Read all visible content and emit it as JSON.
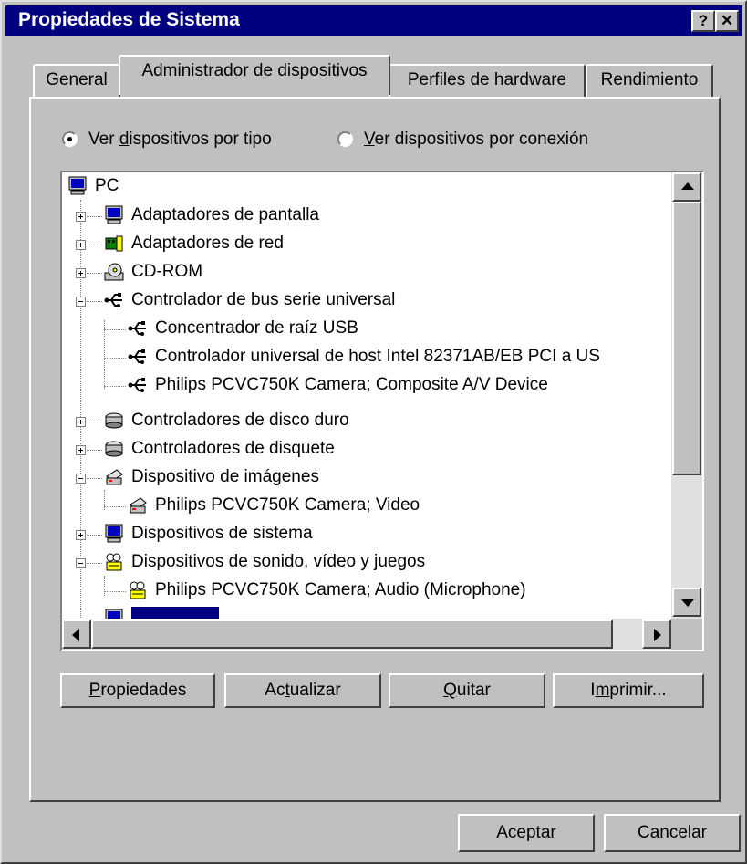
{
  "window": {
    "title": "Propiedades de Sistema",
    "help_glyph": "?",
    "close_glyph": "✕"
  },
  "tabs": [
    {
      "label": "General",
      "active": false
    },
    {
      "label": "Administrador de dispositivos",
      "active": true
    },
    {
      "label": "Perfiles de hardware",
      "active": false
    },
    {
      "label": "Rendimiento",
      "active": false
    }
  ],
  "view_options": {
    "by_type": {
      "mnemonic": "d",
      "before": "Ver ",
      "after": "ispositivos por tipo",
      "selected": true
    },
    "by_connection": {
      "mnemonic": "V",
      "before": "",
      "after": "er dispositivos por conexión",
      "selected": false
    }
  },
  "tree": [
    {
      "label": "PC",
      "icon": "computer-icon"
    },
    {
      "label": "Adaptadores de pantalla",
      "icon": "monitor-icon"
    },
    {
      "label": "Adaptadores de red",
      "icon": "network-card-icon"
    },
    {
      "label": "CD-ROM",
      "icon": "cdrom-icon"
    },
    {
      "label": "Controlador de bus serie universal",
      "icon": "usb-icon"
    },
    {
      "label": "Concentrador de raíz USB",
      "icon": "usb-icon"
    },
    {
      "label": "Controlador universal de host Intel 82371AB/EB PCI a US",
      "icon": "usb-icon"
    },
    {
      "label": "Philips PCVC750K Camera; Composite A/V Device",
      "icon": "usb-icon"
    },
    {
      "label": "Controladores de disco duro",
      "icon": "disk-drive-icon"
    },
    {
      "label": "Controladores de disquete",
      "icon": "disk-drive-icon"
    },
    {
      "label": "Dispositivo de imágenes",
      "icon": "scanner-icon"
    },
    {
      "label": "Philips PCVC750K Camera; Video",
      "icon": "scanner-icon"
    },
    {
      "label": "Dispositivos de sistema",
      "icon": "computer-icon"
    },
    {
      "label": "Dispositivos de sonido, vídeo y juegos",
      "icon": "sound-icon"
    },
    {
      "label": "Philips PCVC750K Camera; Audio (Microphone)",
      "icon": "sound-icon"
    }
  ],
  "buttons": {
    "properties": {
      "mnemonic": "P",
      "rest": "ropiedades"
    },
    "refresh": {
      "before": "Ac",
      "mnemonic": "t",
      "rest": "ualizar"
    },
    "remove": {
      "mnemonic": "Q",
      "rest": "uitar"
    },
    "print": {
      "before": "I",
      "mnemonic": "m",
      "rest": "primir..."
    },
    "ok": "Aceptar",
    "cancel": "Cancelar"
  },
  "colors": {
    "titlebar": "#000080",
    "face": "#c0c0c0",
    "selection": "#000080"
  }
}
